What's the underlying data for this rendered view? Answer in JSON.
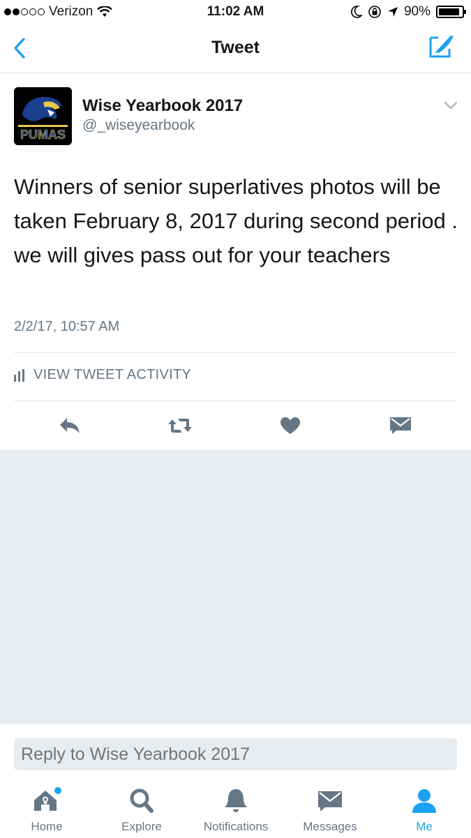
{
  "status_bar": {
    "carrier": "Verizon",
    "time": "11:02 AM",
    "battery": "90%",
    "battery_level": 0.9
  },
  "nav": {
    "title": "Tweet",
    "back_icon": "chevron-left-icon",
    "compose_icon": "compose-tweet-icon"
  },
  "tweet": {
    "author_name": "Wise Yearbook 2017",
    "author_handle": "@_wiseyearbook",
    "avatar_text": "PUMAS",
    "text": "Winners of senior superlatives photos will be taken February 8, 2017 during second period . we will gives pass out for your teachers",
    "timestamp": "2/2/17, 10:57 AM",
    "activity_label": "VIEW TWEET ACTIVITY",
    "actions": [
      "reply-icon",
      "retweet-icon",
      "like-icon",
      "direct-message-icon"
    ]
  },
  "reply": {
    "placeholder": "Reply to Wise Yearbook 2017"
  },
  "tabs": [
    {
      "label": "Home",
      "icon": "home-icon"
    },
    {
      "label": "Explore",
      "icon": "search-icon"
    },
    {
      "label": "Notifications",
      "icon": "bell-icon"
    },
    {
      "label": "Messages",
      "icon": "envelope-icon"
    },
    {
      "label": "Me",
      "icon": "person-icon"
    }
  ],
  "colors": {
    "accent": "#1da1f2",
    "secondary_text": "#657786",
    "background": "#e6ecf0"
  }
}
